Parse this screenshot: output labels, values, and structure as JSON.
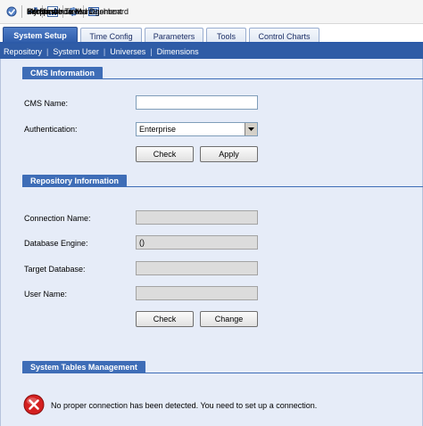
{
  "toolbar": {
    "items": [
      {
        "label": "InfoView",
        "icon": "infoview-icon"
      },
      {
        "label": "Performance Management",
        "icon": "performance-management-icon"
      },
      {
        "label": "My Dashboards",
        "icon": "dashboard-icon"
      },
      {
        "label": "Setup",
        "icon": "setup-gear-icon"
      },
      {
        "label": "Corporate Tiered Dashboard",
        "icon": "corporate-dashboard-icon"
      }
    ]
  },
  "tabs": [
    {
      "label": "System Setup",
      "active": true
    },
    {
      "label": "Time Config",
      "active": false
    },
    {
      "label": "Parameters",
      "active": false
    },
    {
      "label": "Tools",
      "active": false
    },
    {
      "label": "Control Charts",
      "active": false
    }
  ],
  "subnav": [
    "Repository",
    "System User",
    "Universes",
    "Dimensions"
  ],
  "cms": {
    "title": "CMS Information",
    "name_label": "CMS Name:",
    "name_value": "",
    "auth_label": "Authentication:",
    "auth_value": "Enterprise",
    "check_label": "Check",
    "apply_label": "Apply"
  },
  "repo": {
    "title": "Repository Information",
    "conn_label": "Connection Name:",
    "conn_value": "",
    "engine_label": "Database Engine:",
    "engine_value": "()",
    "target_label": "Target Database:",
    "target_value": "",
    "user_label": "User Name:",
    "user_value": "",
    "check_label": "Check",
    "change_label": "Change"
  },
  "tables": {
    "title": "System Tables Management",
    "error_message": "No proper connection has been detected. You need to set up a connection."
  },
  "colors": {
    "accent": "#2f5ca6",
    "section": "#3e6db7",
    "panel": "#e6ecf8",
    "error": "#d42020"
  }
}
